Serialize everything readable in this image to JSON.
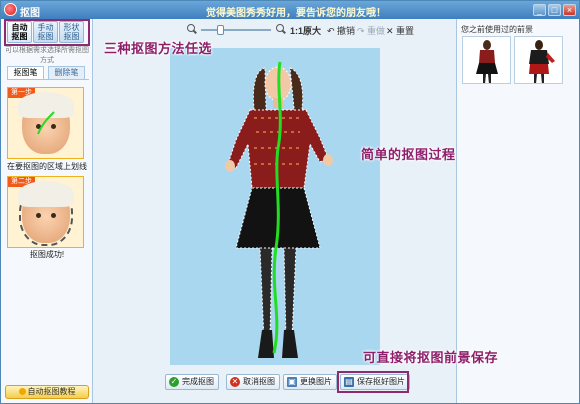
{
  "window": {
    "title": "抠图",
    "promo": "觉得美图秀秀好用，要告诉您的朋友哦！",
    "buttons": {
      "minimize": "_",
      "maximize": "□",
      "close": "×"
    }
  },
  "left_panel": {
    "mode_tabs": [
      {
        "label": "自动抠图",
        "active": true
      },
      {
        "label": "手动抠图",
        "active": false
      },
      {
        "label": "形状抠图",
        "active": false
      }
    ],
    "mode_hint": "可以根据需求选择所需抠图方式",
    "pen_tabs": [
      {
        "label": "抠图笔",
        "active": true
      },
      {
        "label": "删除笔",
        "active": false
      }
    ],
    "steps": [
      {
        "badge": "第一步",
        "caption": "在要抠图的区域上划线"
      },
      {
        "badge": "第二步",
        "caption": "抠图成功!"
      }
    ],
    "tutorial_button": "自动抠图教程"
  },
  "toolbar": {
    "zoom_out_icon": "zoom-out-icon",
    "zoom_in_icon": "zoom-in-icon",
    "zoom_level": 0.25,
    "original_size": "1:1原大",
    "undo": "撤销",
    "redo": "重做",
    "reset": "重置"
  },
  "action_bar": {
    "complete": "完成抠图",
    "cancel": "取消抠图",
    "change_image": "更换图片",
    "save": "保存抠好图片"
  },
  "right_panel": {
    "title": "您之前使用过的前景",
    "thumbnails": [
      "thumbnail-1",
      "thumbnail-2"
    ]
  },
  "annotations": {
    "modes": "三种抠图方法任选",
    "simple": "简单的抠图过程",
    "save": "可直接将抠图前景保存"
  },
  "colors": {
    "annotation": "#8e1f6a",
    "title_bar": "#3f7fbf",
    "photo_bg": "#a8d7ef",
    "stroke": "#22dd22"
  }
}
